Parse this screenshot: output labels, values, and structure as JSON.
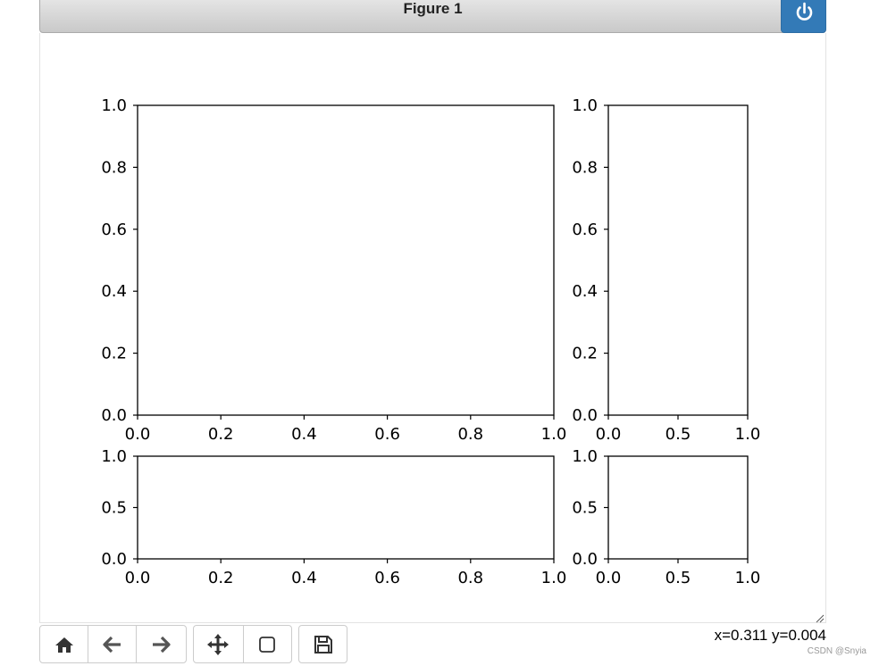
{
  "window": {
    "title": "Figure 1"
  },
  "toolbar": {
    "buttons": [
      {
        "name": "home",
        "icon": "home-icon"
      },
      {
        "name": "back",
        "icon": "arrow-left-icon"
      },
      {
        "name": "forward",
        "icon": "arrow-right-icon"
      },
      {
        "name": "pan",
        "icon": "move-icon"
      },
      {
        "name": "zoom",
        "icon": "zoom-rect-icon"
      },
      {
        "name": "save",
        "icon": "save-icon"
      }
    ]
  },
  "status": {
    "coords": "x=0.311 y=0.004"
  },
  "watermark": "CSDN @Snyia",
  "colors": {
    "close_button": "#337ab7",
    "titlebar": "#d4d4d4"
  },
  "chart_data": [
    {
      "type": "empty-axes",
      "xlim": [
        0,
        1
      ],
      "ylim": [
        0,
        1
      ],
      "xticks": [
        "0.0",
        "0.2",
        "0.4",
        "0.6",
        "0.8",
        "1.0"
      ],
      "yticks": [
        "0.0",
        "0.2",
        "0.4",
        "0.6",
        "0.8",
        "1.0"
      ]
    },
    {
      "type": "empty-axes",
      "xlim": [
        0,
        1
      ],
      "ylim": [
        0,
        1
      ],
      "xticks": [
        "0.0",
        "0.5",
        "1.0"
      ],
      "yticks": [
        "0.0",
        "0.2",
        "0.4",
        "0.6",
        "0.8",
        "1.0"
      ]
    },
    {
      "type": "empty-axes",
      "xlim": [
        0,
        1
      ],
      "ylim": [
        0,
        1
      ],
      "xticks": [
        "0.0",
        "0.2",
        "0.4",
        "0.6",
        "0.8",
        "1.0"
      ],
      "yticks": [
        "0.0",
        "0.5",
        "1.0"
      ]
    },
    {
      "type": "empty-axes",
      "xlim": [
        0,
        1
      ],
      "ylim": [
        0,
        1
      ],
      "xticks": [
        "0.0",
        "0.5",
        "1.0"
      ],
      "yticks": [
        "0.0",
        "0.5",
        "1.0"
      ]
    }
  ]
}
